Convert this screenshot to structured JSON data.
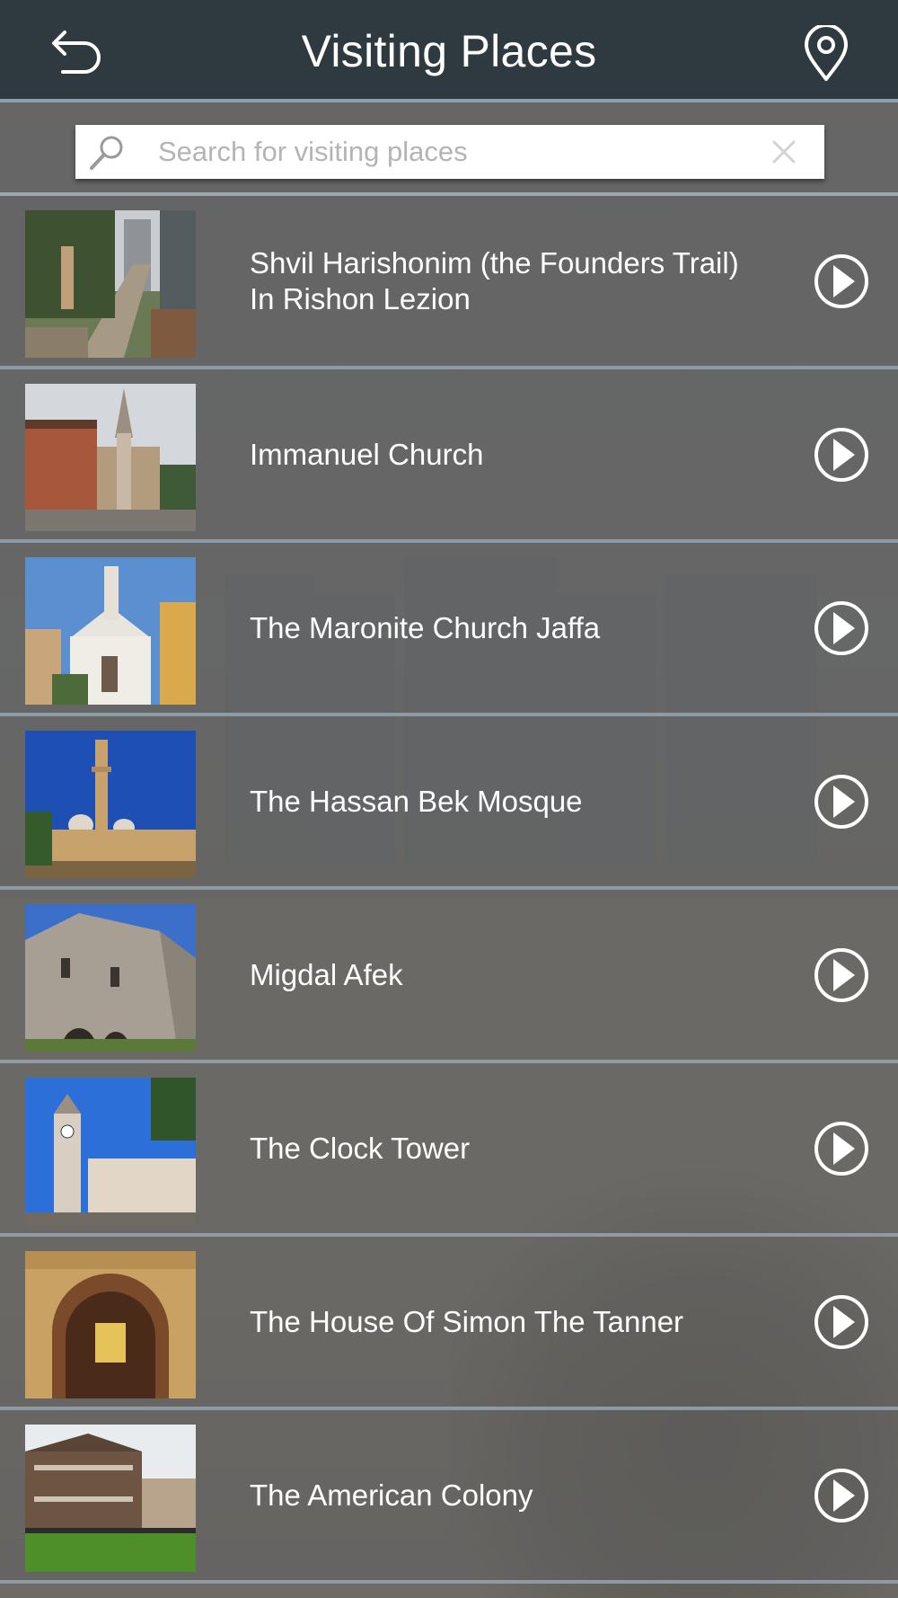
{
  "header": {
    "title": "Visiting Places",
    "back_icon": "back-arrow-icon",
    "map_icon": "location-pin-icon"
  },
  "search": {
    "placeholder": "Search for visiting places",
    "value": ""
  },
  "places": [
    {
      "name": "Shvil Harishonim (the Founders Trail) In Rishon Lezion",
      "thumb": "street-trail"
    },
    {
      "name": "Immanuel Church",
      "thumb": "church-spire"
    },
    {
      "name": "The Maronite Church Jaffa",
      "thumb": "white-church"
    },
    {
      "name": "The Hassan Bek Mosque",
      "thumb": "mosque-minaret"
    },
    {
      "name": "Migdal Afek",
      "thumb": "stone-fortress"
    },
    {
      "name": "The Clock Tower",
      "thumb": "clock-tower"
    },
    {
      "name": "The House Of Simon The Tanner",
      "thumb": "stone-arch-doorway"
    },
    {
      "name": "The American Colony",
      "thumb": "wooden-house"
    }
  ],
  "colors": {
    "header_bg": "#2f3a40",
    "divider": "#9aa8b0",
    "text": "#ffffff"
  }
}
